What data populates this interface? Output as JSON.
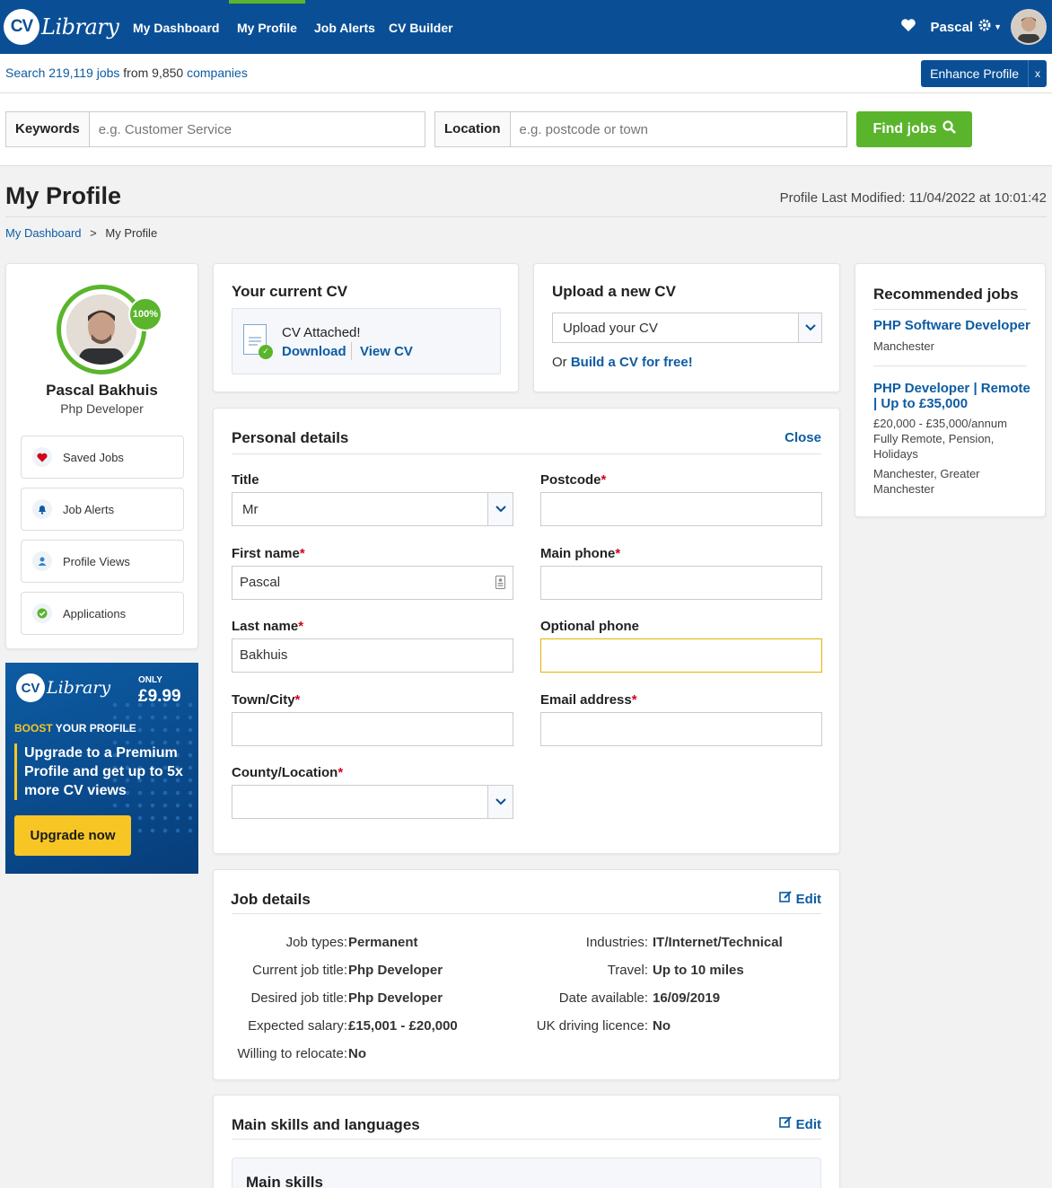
{
  "nav": {
    "logo": "Library",
    "logo_cv": "CV",
    "items": [
      "My Dashboard",
      "My Profile",
      "Job Alerts",
      "CV Builder"
    ],
    "user": "Pascal"
  },
  "subbar": {
    "search": "Search",
    "jobs": "219,119 jobs",
    "from": "from",
    "companies_count": "9,850",
    "companies": "companies",
    "enhance": "Enhance Profile",
    "close": "x"
  },
  "search": {
    "kw_label": "Keywords",
    "kw_placeholder": "e.g. Customer Service",
    "loc_label": "Location",
    "loc_placeholder": "e.g. postcode or town",
    "find": "Find jobs"
  },
  "page": {
    "title": "My Profile",
    "modified": "Profile Last Modified: 11/04/2022 at 10:01:42",
    "crumb1": "My Dashboard",
    "crumb_sep": ">",
    "crumb2": "My Profile"
  },
  "profile": {
    "percent": "100%",
    "name": "Pascal Bakhuis",
    "role": "Php Developer",
    "buttons": [
      "Saved Jobs",
      "Job Alerts",
      "Profile Views",
      "Applications"
    ]
  },
  "promo": {
    "logo": "Library",
    "logo_cv": "CV",
    "only": "ONLY",
    "price": "£9.99",
    "boost_a": "BOOST",
    "boost_b": " YOUR PROFILE",
    "text": "Upgrade to a Premium Profile and get up to 5x more CV views",
    "button": "Upgrade now"
  },
  "current_cv": {
    "title": "Your current CV",
    "attached": "CV Attached!",
    "download": "Download",
    "view": "View CV"
  },
  "upload": {
    "title": "Upload a new CV",
    "select": "Upload your CV",
    "or": "Or",
    "build": "Build a CV for free!"
  },
  "personal": {
    "title": "Personal details",
    "close": "Close",
    "title_label": "Title",
    "title_value": "Mr",
    "first_label": "First name",
    "first_value": "Pascal",
    "last_label": "Last name",
    "last_value": "Bakhuis",
    "town_label": "Town/City",
    "town_value": "",
    "county_label": "County/Location",
    "county_value": "",
    "postcode_label": "Postcode",
    "postcode_value": "",
    "phone_label": "Main phone",
    "phone_value": "",
    "optphone_label": "Optional phone",
    "optphone_value": "",
    "email_label": "Email address",
    "email_value": "",
    "required": "*"
  },
  "job": {
    "title": "Job details",
    "edit": "Edit",
    "left": [
      [
        "Job types:",
        "Permanent"
      ],
      [
        "Current job title:",
        "Php Developer"
      ],
      [
        "Desired job title:",
        "Php Developer"
      ],
      [
        "Expected salary:",
        "£15,001 - £20,000"
      ],
      [
        "Willing to relocate:",
        "No"
      ]
    ],
    "right": [
      [
        "Industries:",
        "IT/Internet/Technical"
      ],
      [
        "Travel:",
        "Up to 10 miles"
      ],
      [
        "Date available:",
        "16/09/2019"
      ],
      [
        "UK driving licence:",
        "No"
      ]
    ]
  },
  "skills": {
    "title": "Main skills and languages",
    "edit": "Edit",
    "sub": "Main skills"
  },
  "recommended": {
    "title": "Recommended jobs",
    "jobs": [
      {
        "title": "PHP Software Developer",
        "meta1": "Manchester"
      },
      {
        "title": "PHP Developer | Remote | Up to £35,000",
        "meta1": "£20,000 - £35,000/annum",
        "meta2": "Fully Remote, Pension, Holidays",
        "meta3": "Manchester, Greater Manchester"
      }
    ]
  },
  "colors": {
    "brand": "#0a4f96",
    "green": "#5ab52c",
    "yellow": "#f7c625",
    "link": "#0d5ca3"
  },
  "icons": [
    "heart-icon",
    "gear-icon",
    "search-icon",
    "bell-icon",
    "user-icon",
    "check-icon",
    "edit-icon",
    "chevron-down-icon",
    "contact-card-icon",
    "cv-document-icon"
  ]
}
